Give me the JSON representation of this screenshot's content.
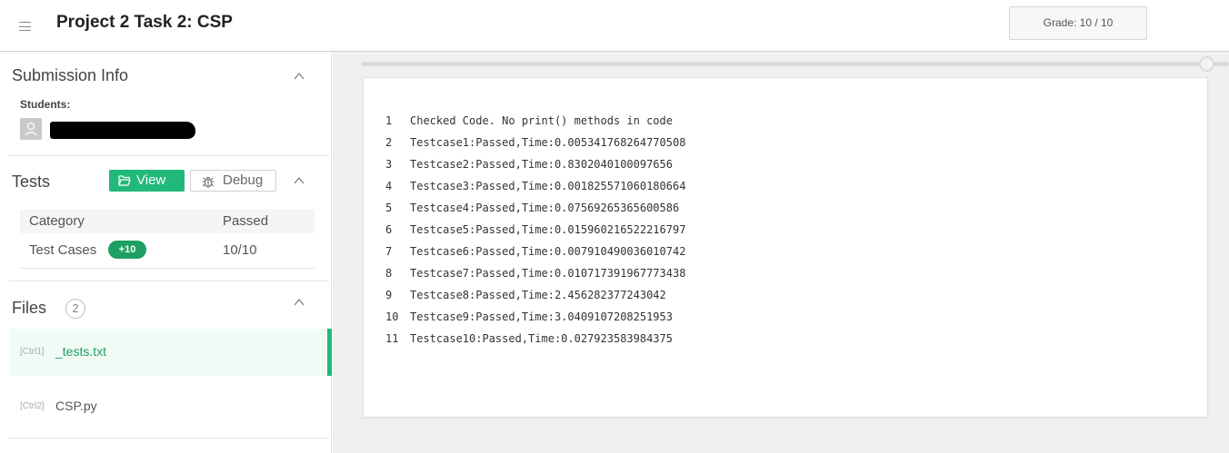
{
  "header": {
    "title": "Project 2 Task 2: CSP",
    "grade": "Grade: 10 / 10"
  },
  "submission": {
    "title": "Submission Info",
    "students_label": "Students:"
  },
  "tests": {
    "title": "Tests",
    "view_label": "View",
    "debug_label": "Debug",
    "columns": [
      "Category",
      "Passed"
    ],
    "rows": [
      {
        "category": "Test Cases",
        "badge": "+10",
        "passed": "10/10"
      }
    ]
  },
  "files": {
    "title": "Files",
    "count": "2",
    "items": [
      {
        "key": "[Ctrl1]",
        "name": "_tests.txt",
        "active": true
      },
      {
        "key": "[Ctrl2]",
        "name": "CSP.py",
        "active": false
      }
    ]
  },
  "code_lines": [
    {
      "n": "1",
      "text": "Checked Code. No print() methods in code"
    },
    {
      "n": "2",
      "text": "Testcase1:Passed,Time:0.005341768264770508"
    },
    {
      "n": "3",
      "text": "Testcase2:Passed,Time:0.8302040100097656"
    },
    {
      "n": "4",
      "text": "Testcase3:Passed,Time:0.001825571060180664"
    },
    {
      "n": "5",
      "text": "Testcase4:Passed,Time:0.07569265365600586"
    },
    {
      "n": "6",
      "text": "Testcase5:Passed,Time:0.015960216522216797"
    },
    {
      "n": "7",
      "text": "Testcase6:Passed,Time:0.007910490036010742"
    },
    {
      "n": "8",
      "text": "Testcase7:Passed,Time:0.010717391967773438"
    },
    {
      "n": "9",
      "text": "Testcase8:Passed,Time:2.456282377243042"
    },
    {
      "n": "10",
      "text": "Testcase9:Passed,Time:3.0409107208251953"
    },
    {
      "n": "11",
      "text": "Testcase10:Passed,Time:0.027923583984375"
    }
  ],
  "colors": {
    "accent": "#21b97a",
    "badge": "#1f9e63"
  }
}
